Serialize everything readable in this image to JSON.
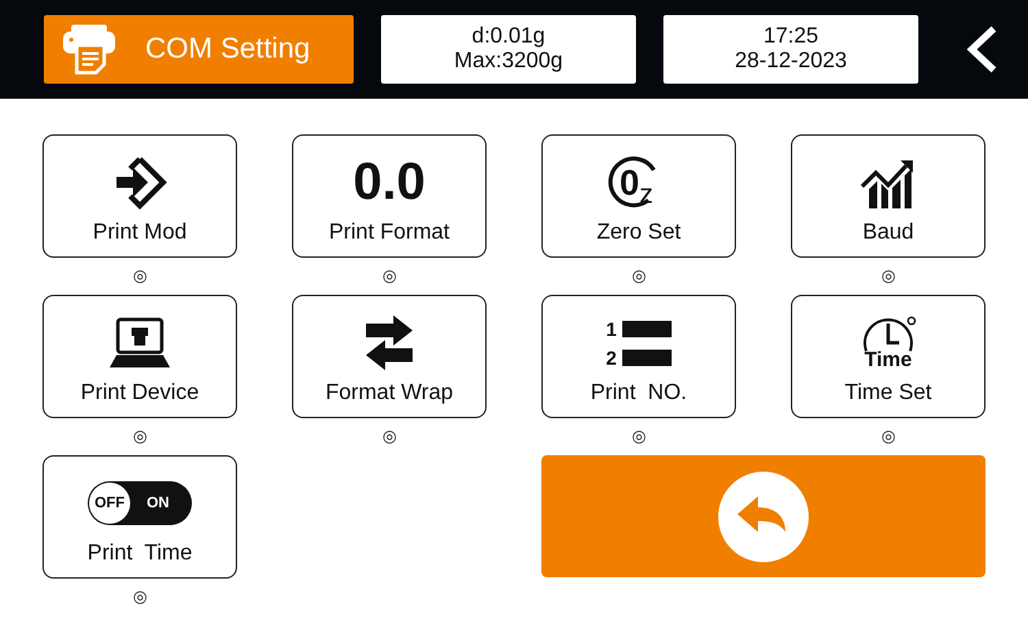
{
  "header": {
    "title": "COM Setting",
    "info_lines": [
      "d:0.01g",
      "Max:3200g"
    ],
    "datetime_lines": [
      "17:25",
      "28-12-2023"
    ]
  },
  "tiles": [
    {
      "label": "Print Mod",
      "kind": "enter",
      "mark": "◎"
    },
    {
      "label": "Print Format",
      "kind": "digits",
      "icon_texts": [
        "0.0"
      ],
      "mark": "◎"
    },
    {
      "label": "Zero Set",
      "kind": "zero",
      "icon_texts": [
        "0",
        "z"
      ],
      "mark": "◎"
    },
    {
      "label": "Baud",
      "kind": "chart",
      "mark": "◎"
    },
    {
      "label": "Print Device",
      "kind": "laptop",
      "mark": "◎"
    },
    {
      "label": "Format Wrap",
      "kind": "swap",
      "mark": "◎"
    },
    {
      "label": "Print  NO.",
      "kind": "numbered",
      "icon_texts": [
        "1",
        "2"
      ],
      "mark": "◎"
    },
    {
      "label": "Time Set",
      "kind": "clock",
      "icon_texts": [
        "Time"
      ],
      "mark": "◎"
    },
    {
      "label": "Print  Time",
      "kind": "toggle",
      "icon_texts": [
        "OFF",
        "ON"
      ],
      "mark": "◎"
    }
  ]
}
